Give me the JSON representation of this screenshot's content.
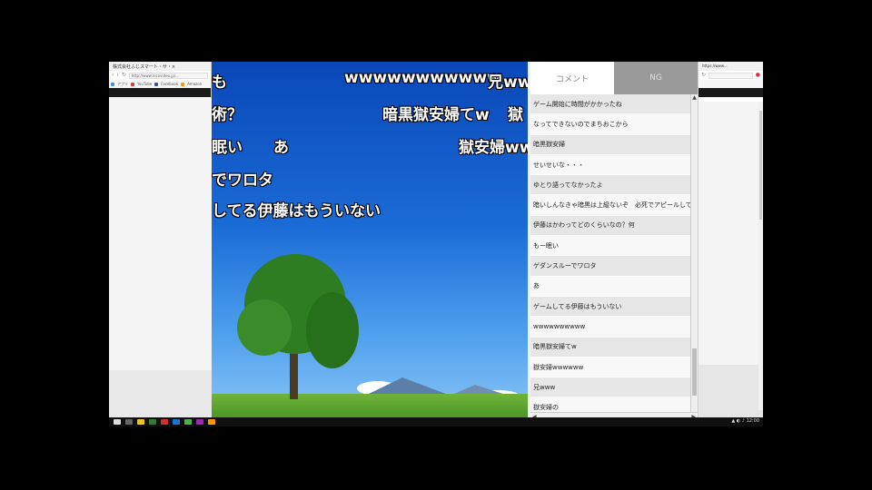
{
  "left_browser": {
    "tab_title": "株式会社ふじスマート・サ・×",
    "url": "http://www.nicovideo.jp/...",
    "bookmarks": [
      "アプリ",
      "YouTube",
      "Facebook",
      "Amazon"
    ]
  },
  "right_browser": {
    "tab_title": "https://www..."
  },
  "video": {
    "danmaku": [
      "も",
      "wwwwwwwwwww",
      "兄www",
      "術？",
      "暗黒獄安婦てw",
      "獄",
      "眠い",
      "あ",
      "獄安婦wwww",
      "でワロタ",
      "してる伊藤はもういない"
    ]
  },
  "comment_panel": {
    "tabs": [
      "コメント",
      "NG"
    ],
    "comments": [
      "ゲーム開始に時間がかかったね",
      "なってできないのでまちおこから",
      "暗黒獄安婦",
      "せいせいな・・・",
      "ゆとり語ってなかったよ",
      "暗いしんなきゃ暗黒は上級ないぞ　必死でアピールしてる",
      "伊藤はかわってどのくらいなの？何",
      "もー眠い",
      "ゲダンスルーでワロタ",
      "あ",
      "ゲームしてる伊藤はもういない",
      "wwwwwwwwww",
      "暗黒獄安婦てw",
      "獄安婦wwwwww",
      "兄www",
      "獄安婦の"
    ]
  },
  "taskbar": {
    "tray_text": "▲ ◐ ♪ 12:00"
  },
  "colors": {
    "sky_top": "#0a47b8",
    "sky_bottom": "#8fc9f5",
    "grass": "#3f8a1f",
    "tree": "#2f7d22",
    "comment_row_odd": "#e6e6e6",
    "comment_row_even": "#f8f8f8",
    "inactive_tab": "#9a9a9a"
  }
}
